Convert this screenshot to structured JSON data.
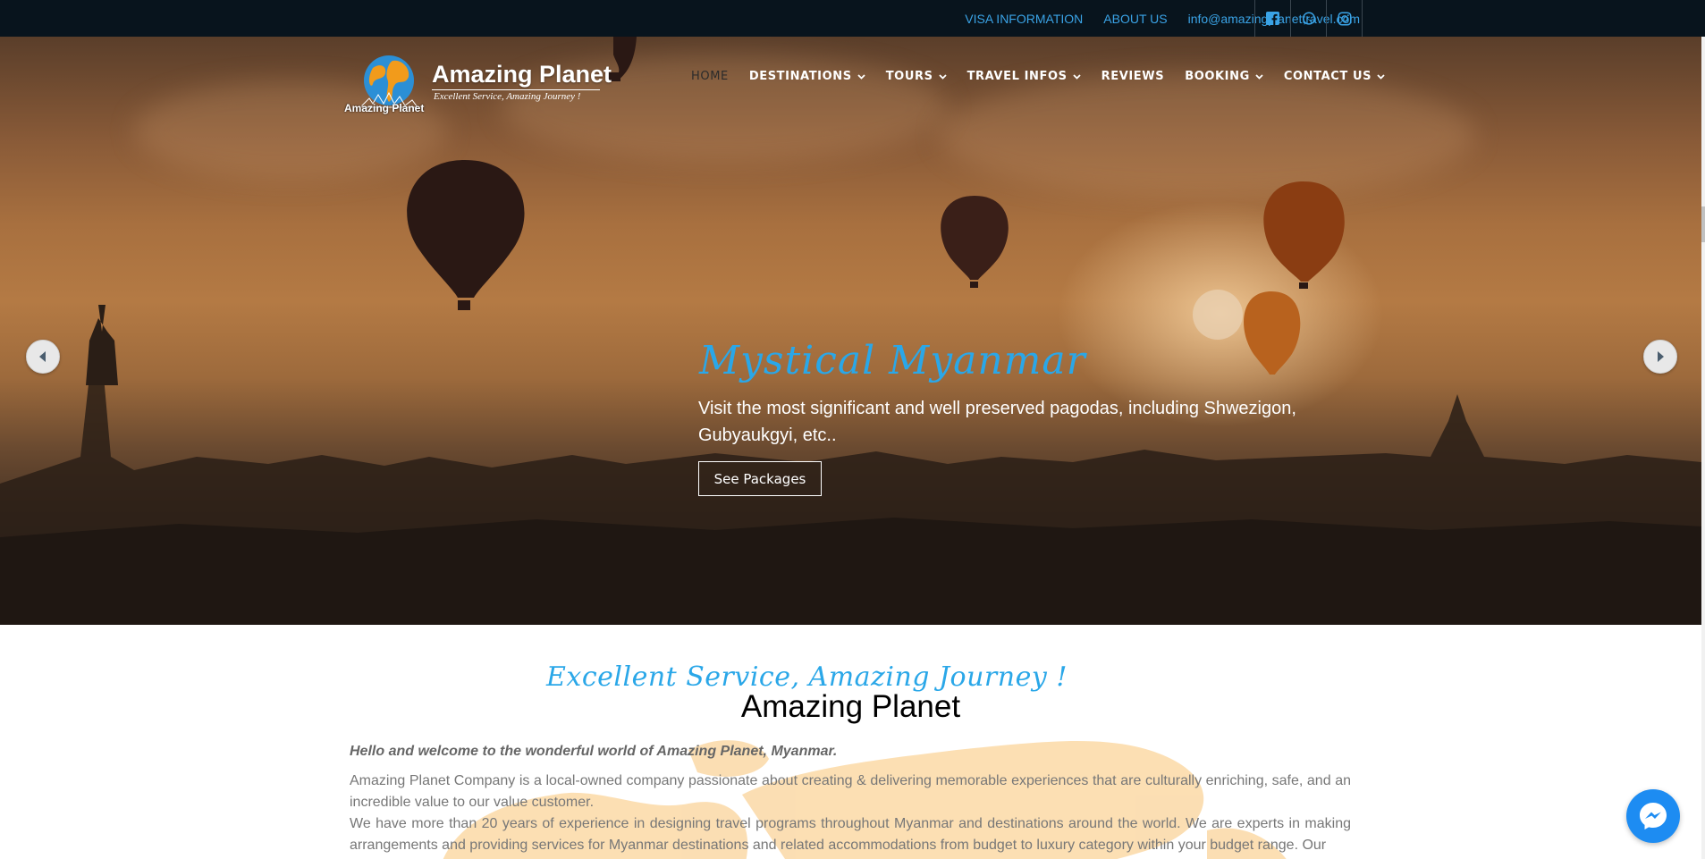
{
  "topbar": {
    "links": [
      "VISA INFORMATION",
      "ABOUT US",
      "info@amazingplanettravel.com"
    ],
    "socials": [
      "facebook-icon",
      "whatsapp-icon",
      "instagram-icon"
    ]
  },
  "brand": {
    "name": "Amazing Planet",
    "tagline": "Excellent Service, Amazing Journey !",
    "small_name": "Amazing Planet"
  },
  "nav": {
    "items": [
      {
        "label": "HOME",
        "dropdown": false,
        "active": true
      },
      {
        "label": "DESTINATIONS",
        "dropdown": true,
        "active": false
      },
      {
        "label": "TOURS",
        "dropdown": true,
        "active": false
      },
      {
        "label": "TRAVEL INFOS",
        "dropdown": true,
        "active": false
      },
      {
        "label": "REVIEWS",
        "dropdown": false,
        "active": false
      },
      {
        "label": "BOOKING",
        "dropdown": true,
        "active": false
      },
      {
        "label": "CONTACT US",
        "dropdown": true,
        "active": false
      }
    ]
  },
  "slider": {
    "title": "Mystical Myanmar",
    "text": "Visit the most significant and well preserved pagodas, including Shwezigon, Gubyaukgyi, etc..",
    "button_label": "See Packages"
  },
  "content": {
    "tagline": "Excellent Service, Amazing Journey !",
    "title": "Amazing Planet",
    "welcome": "Hello and welcome to the wonderful world of Amazing Planet, Myanmar.",
    "paragraph1": "Amazing Planet Company is a local-owned company passionate about creating & delivering memorable experiences that are culturally enriching, safe, and an incredible value to our value customer.",
    "paragraph2": "We have more than 20 years of experience in designing travel programs throughout Myanmar and destinations around the world. We are experts in making arrangements and providing services for Myanmar destinations and related accommodations from budget to luxury category within your budget range.  Our"
  },
  "colors": {
    "accent": "#2aa7e8",
    "topbar_bg": "#08141d",
    "messenger": "#1d8cf2"
  }
}
